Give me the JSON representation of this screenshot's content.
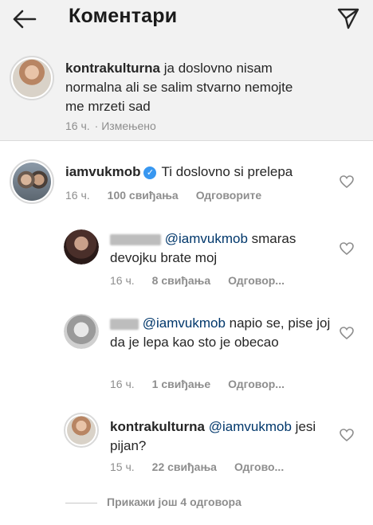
{
  "header": {
    "title": "Коментари"
  },
  "caption": {
    "username": "kontrakulturna",
    "text": " ja doslovno nisam normalna ali se salim stvarno nemojte me mrzeti sad",
    "meta_time": "16 ч.",
    "meta_edited": "· Измењено"
  },
  "comments": [
    {
      "username": "iamvukmob",
      "verified": true,
      "text": "Ti doslovno si prelepa",
      "time": "16 ч.",
      "likes": "100 свиђања",
      "reply": "Одговорите"
    }
  ],
  "replies": [
    {
      "mention": "@iamvukmob",
      "text": " smaras devojku brate moj",
      "time": "16 ч.",
      "likes": "8 свиђања",
      "reply": "Одговор..."
    },
    {
      "mention": "@iamvukmob",
      "text": " napio se, pise joj da je lepa kao sto je obecao",
      "time": "16 ч.",
      "likes": "1 свиђање",
      "reply": "Одговор..."
    },
    {
      "username": "kontrakulturna",
      "mention": "@iamvukmob",
      "text": " jesi pijan?",
      "time": "15 ч.",
      "likes": "22 свиђања",
      "reply": "Одгово..."
    }
  ],
  "footer": {
    "more_replies": "Прикажи још 4 одговора"
  },
  "colors": {
    "mention": "#00376b",
    "verified": "#3897f0",
    "meta": "#8e8e8e",
    "header_bg": "#f2f2f2"
  },
  "icons": [
    "back-arrow-icon",
    "direct-send-icon",
    "heart-outline-icon",
    "verified-badge-icon"
  ]
}
